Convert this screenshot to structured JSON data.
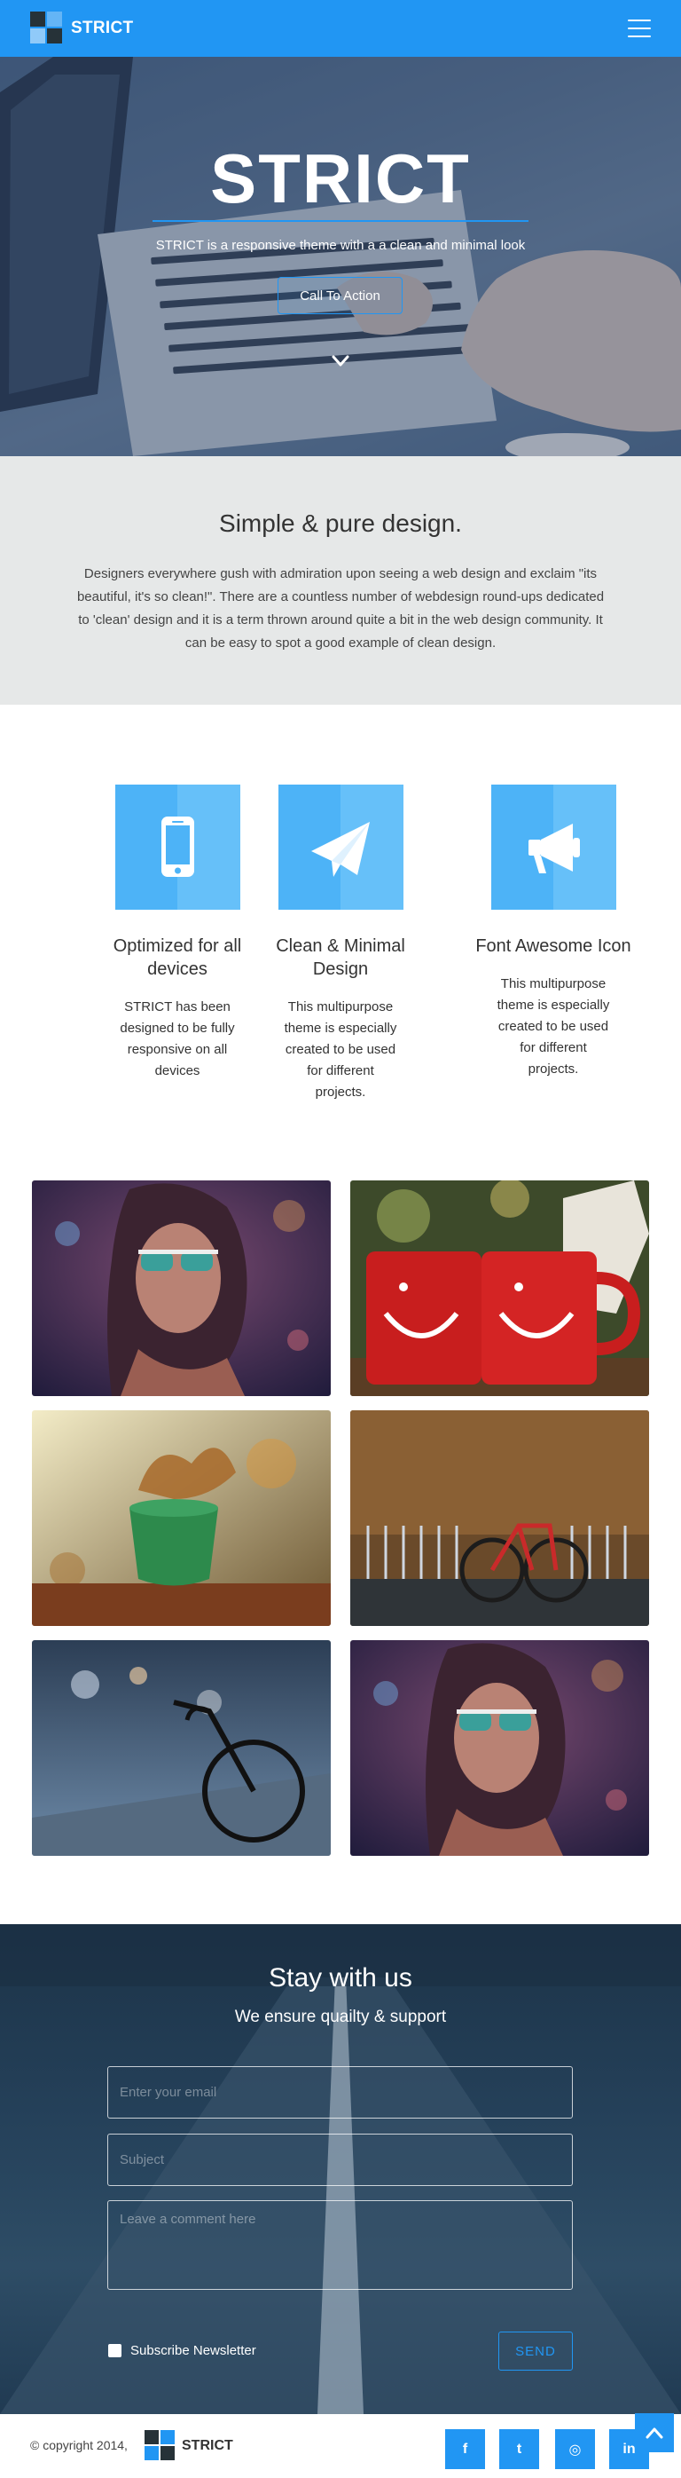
{
  "header": {
    "brand": "STRICT",
    "menu_icon": "hamburger-menu-icon"
  },
  "hero": {
    "title": "STRICT",
    "subtitle": "STRICT is a responsive theme with a a clean and minimal look",
    "cta_label": "Call To Action",
    "scroll_icon": "chevron-down-icon"
  },
  "intro": {
    "heading": "Simple & pure design.",
    "body": "Designers everywhere gush with admiration upon seeing a web design and exclaim \"its beautiful, it's so clean!\". There are a countless number of webdesign round-ups dedicated to 'clean' design and it is a term thrown around quite a bit in the web design community. It can be easy to spot a good example of clean design."
  },
  "features": [
    {
      "icon": "mobile-phone-icon",
      "title": "Optimized for all devices",
      "text": "STRICT has been designed to be fully responsive on all devices"
    },
    {
      "icon": "paper-plane-icon",
      "title": "Clean & Minimal Design",
      "text": "This multipurpose theme is especially created to be used for different projects."
    },
    {
      "icon": "megaphone-icon",
      "title": "Font Awesome Icon",
      "text": "This multipurpose theme is especially created to be used for different projects."
    }
  ],
  "gallery": [
    {
      "subject": "woman-sunglasses-bokeh"
    },
    {
      "subject": "red-smiley-mugs"
    },
    {
      "subject": "green-cup-splash"
    },
    {
      "subject": "red-bicycle-wall"
    },
    {
      "subject": "bicycle-street-bokeh"
    },
    {
      "subject": "woman-sunglasses-bokeh"
    }
  ],
  "contact": {
    "heading": "Stay with us",
    "lead": "We ensure quailty & support",
    "email_placeholder": "Enter your email",
    "subject_placeholder": "Subject",
    "comment_placeholder": "Leave a comment here",
    "subscribe_label": "Subscribe Newsletter",
    "send_label": "SEND"
  },
  "footer": {
    "copyright": "© copyright 2014,",
    "brand": "STRICT",
    "social": [
      {
        "icon": "facebook-icon",
        "glyph": "f"
      },
      {
        "icon": "twitter-icon",
        "glyph": "t"
      },
      {
        "icon": "dribbble-icon",
        "glyph": "◎"
      },
      {
        "icon": "linkedin-icon",
        "glyph": "in"
      }
    ],
    "back_to_top_icon": "chevron-up-icon"
  },
  "colors": {
    "primary": "#2196f3",
    "feature_tile": "#4db3f7",
    "intro_bg": "#e6e8e8"
  }
}
